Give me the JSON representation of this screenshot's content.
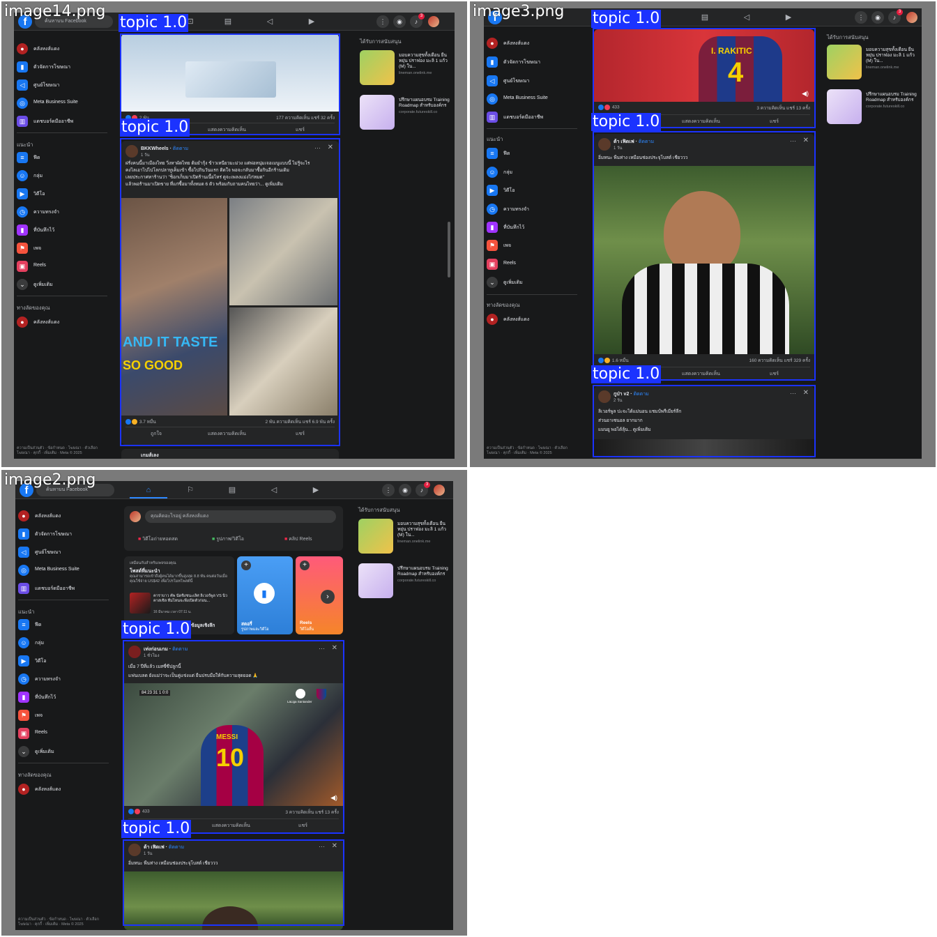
{
  "tiles": [
    {
      "label": "image14.png"
    },
    {
      "label": "image3.png"
    },
    {
      "label": "image2.png"
    }
  ],
  "detection_label": "topic 1.0",
  "search_placeholder": "ค้นหาบน Facebook",
  "sidebar": {
    "items": [
      "คลังหงส์แดง",
      "ตัวจัดการโฆษณา",
      "ศูนย์โฆษณา",
      "Meta Business Suite",
      "แดชบอร์ดมืออาชีพ"
    ],
    "section_recommended": "แนะนำ",
    "recommended": [
      "ฟีด",
      "กลุ่ม",
      "วิดีโอ",
      "ความทรงจำ",
      "ที่บันทึกไว้",
      "เพจ",
      "Reels",
      "ดูเพิ่มเติม"
    ],
    "section_shortcuts": "ทางลัดของคุณ",
    "shortcuts": [
      "คลังหงส์แดง"
    ],
    "footer": "ความเป็นส่วนตัว · ข้อกำหนด · โฆษณา · ตัวเลือกโฆษณา · คุกกี้ · เพิ่มเติม · Meta © 2025"
  },
  "sponsored": {
    "heading": "ได้รับการสนับสนุน",
    "ads": [
      {
        "title": "มอบความสุขทั้งเดือน ยืนหยุ่น ปราฟอง มะลิ 1 แก้ว (M) ใน...",
        "url": "lineman.onelink.me",
        "thumb_color": "#8bc34a"
      },
      {
        "title": "ปรึกษาแผนอบรม Training Roadmap สำหรับองค์กร",
        "url": "corporate.futureskill.co",
        "thumb_color": "#d8c7f0"
      }
    ]
  },
  "notification_count": "3",
  "img14": {
    "post1": {
      "reactions": "2 พัน",
      "stats": "177 ความคิดเห็น แชร์ 32 ครั้ง",
      "comment": "แสดงความคิดเห็น",
      "share": "แชร์"
    },
    "post2": {
      "name": "BKKWheels",
      "follow": "ติดตาม",
      "time": "1 วัน",
      "text": [
        "ฝรั่งคนนี้มาเมืองไทย วิ่งหาผัดไทย ต้มยำกุ้ง ข้าวเหนียวมะม่วง แต่พ่อหนุ่มเจอเมนูแบบนี้ ไม่รู้จะไร",
        "คงไลเอาไปไปโลกปลาทูเค็มเข้า ซื้อไปกินวันแรก ติดใจ พอจะกลับมาซื้อกินอีกร้านเดิม",
        "เลยประกาศหาร้านว่า \"ช็อกเก็บมาเปิดร้านเนื้อไหร่ ดูจะเพลงแม่งไก่หมด\"",
        "แล้วพอร้านมาเปิดขาย ที่แก่ซื้อมาทั้งหมด 6 ตัว พร้อมกับถามคนไทยว่า... ดูเพิ่มเติม"
      ],
      "overlay_1": "AND IT TASTE",
      "overlay_2": "SO GOOD",
      "reactions": "3.7 หมื่น",
      "stats": "2 พัน ความคิดเห็น แชร์ 6.9 พัน ครั้ง",
      "like": "ถูกใจ",
      "comment": "แสดงความคิดเห็น",
      "share": "แชร์"
    },
    "post3_name": "เกมส์เลง"
  },
  "img3": {
    "post1": {
      "jersey_name": "I. RAKITIC",
      "jersey_number": "4",
      "reactions": "433",
      "stats": "3 ความคิดเห็น แชร์ 13 ครั้ง",
      "comment": "แสดงความคิดเห็น",
      "share": "แชร์"
    },
    "post2": {
      "name": "ต้า เฟิดเฟ",
      "follow": "ติดตาม",
      "time": "1 วัน",
      "text": "อิ่มหนะ พืนท่าง เหมือนช่องประจุโบสต์ เชียววว",
      "reactions": "1.6 หมื่น",
      "stats": "160 ความคิดเห็น แชร์ 329 ครั้ง",
      "comment": "แสดงความคิดเห็น",
      "share": "แชร์"
    },
    "post3": {
      "name": "กูป่า v2",
      "follow": "ติดตาม",
      "time": "2 วัน",
      "text": [
        "ลิเวอร์พูล ปะจะได้แม่นอน แชมป์พรีเมียร์ลีก",
        "ส่วนอาเซนอล     ยากมาก",
        "แมนยู     พอได้ลุ้น... ดูเพิ่มเติม"
      ]
    }
  },
  "img2": {
    "composer_placeholder": "คุณคิดอะไรอยู่ คลังหงส์แดง",
    "composer_actions": [
      "วิดีโอถ่ายทอดสด",
      "รูปภาพ/วิดีโอ",
      "คลิป Reels"
    ],
    "suggested": {
      "tag": "เหมือนกับสำหรับเพจของคุณ",
      "title": "โพสต์ที่แนะนำ",
      "desc": "คุณสามารถเข้าถึงผู้คนได้มากขึ้นสูงสุด 8.8 พัน คนต่อวันเมื่อคุณใช้จ่าย US$42 เพื่อโปรโมทโพสต์นี้",
      "item": "คาราบาว คัพ นัดชิงชนะเลิศ ลิเวอร์พูล VS นิวคาสเซิล ทีมไหนจะพึงเปิดตัวก่อน...",
      "item_date": "16 มีนาคม เวลา 07:11 น.",
      "button": "ข้อมูลเชิงลึก"
    },
    "stories": [
      {
        "title": "สตอรี่",
        "sub": "รูปภาพและวิดีโอ"
      },
      {
        "title": "Reels",
        "sub": "วิดีโอสั้น"
      }
    ],
    "post1": {
      "name": "เท่งก่อนเกม",
      "follow": "ติดตาม",
      "time": "1 ชั่วโมง",
      "text": [
        "เมื่อ 7 ปีที่แล้ว เมสซี่ซีปลูกนี้",
        "แฟนเบลด ยังแม่ว่าจะเป็นคู่แข่งแต่ ยืนปรบมือให้กับความสุดยอด 🙏"
      ],
      "scoreboard": "84:23 31 1 0:0",
      "league": "LaLiga Santander",
      "jersey_name": "MESSI",
      "jersey_number": "10",
      "reactions": "433",
      "stats": "3 ความคิดเห็น แชร์ 13 ครั้ง",
      "comment": "แสดงความคิดเห็น",
      "share": "แชร์"
    },
    "post2": {
      "name": "ต้า เฟิดเฟ",
      "follow": "ติดตาม",
      "time": "1 วัน",
      "text": "อิ่มหนะ พืนท่าง เหมือนช่องประจุโบสต์ เชียววว"
    }
  }
}
